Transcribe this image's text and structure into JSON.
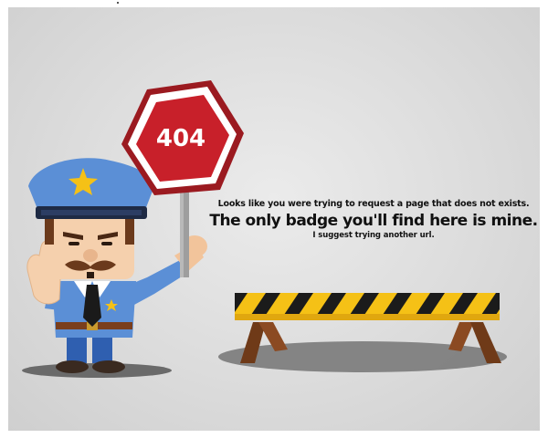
{
  "error": {
    "code": "404",
    "message_line1": "Looks like you were trying to request a page that does not exists.",
    "message_line2": "The only badge you'll find here is mine.",
    "message_line3": "I suggest trying another url."
  },
  "colors": {
    "background": "#dcdcdc",
    "sign_red": "#c8202a",
    "sign_dark_red": "#9b1a20",
    "police_blue": "#5b8fd6",
    "hat_blue": "#4f7fc8",
    "barrier_yellow": "#f5c116",
    "barrier_black": "#1b1b1b",
    "barrier_legs": "#8b4a22"
  }
}
